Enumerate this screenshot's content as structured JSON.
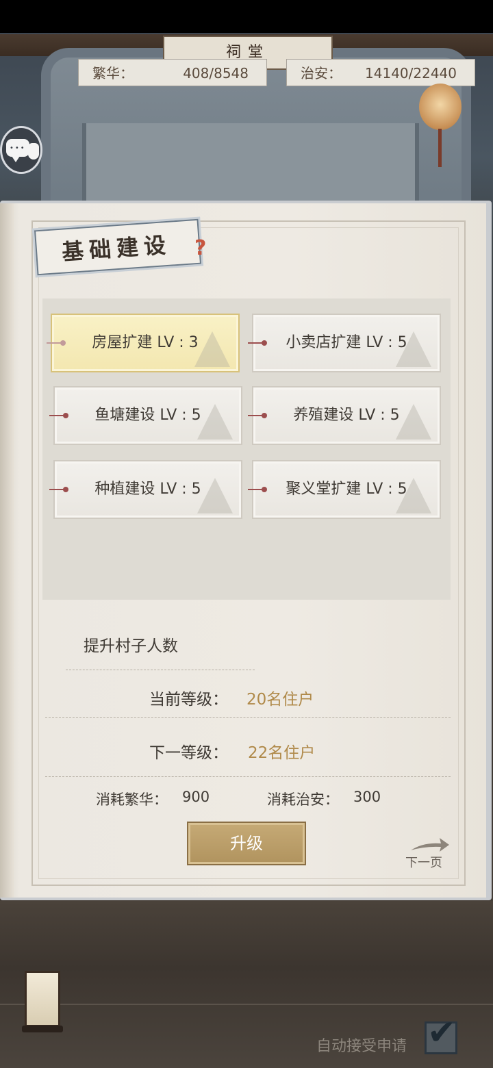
{
  "header": {
    "building_sign": "祠堂",
    "prosperity": {
      "label": "繁华：",
      "value": "408/8548"
    },
    "security": {
      "label": "治安：",
      "value": "14140/22440"
    }
  },
  "panel": {
    "title": "基础建设",
    "buildings": [
      {
        "name": "房屋扩建 LV : 3",
        "selected": true
      },
      {
        "name": "小卖店扩建 LV : 5",
        "selected": false
      },
      {
        "name": "鱼塘建设 LV : 5",
        "selected": false
      },
      {
        "name": "养殖建设 LV : 5",
        "selected": false
      },
      {
        "name": "种植建设 LV : 5",
        "selected": false
      },
      {
        "name": "聚义堂扩建 LV : 5",
        "selected": false
      }
    ],
    "detail": {
      "title": "提升村子人数",
      "current_label": "当前等级：",
      "current_value": "20名住户",
      "next_label": "下一等级：",
      "next_value": "22名住户",
      "cost_prosperity_label": "消耗繁华：",
      "cost_prosperity_value": "900",
      "cost_security_label": "消耗治安：",
      "cost_security_value": "300"
    },
    "upgrade_button": "升级",
    "next_page": "下一页"
  },
  "footer": {
    "auto_accept_label": "自动接受申请",
    "auto_accept_checked": true
  },
  "colors": {
    "accent_gold": "#b08a4a",
    "selected_tile": "#f6ecbd",
    "button_bg": "#bfa06a"
  }
}
